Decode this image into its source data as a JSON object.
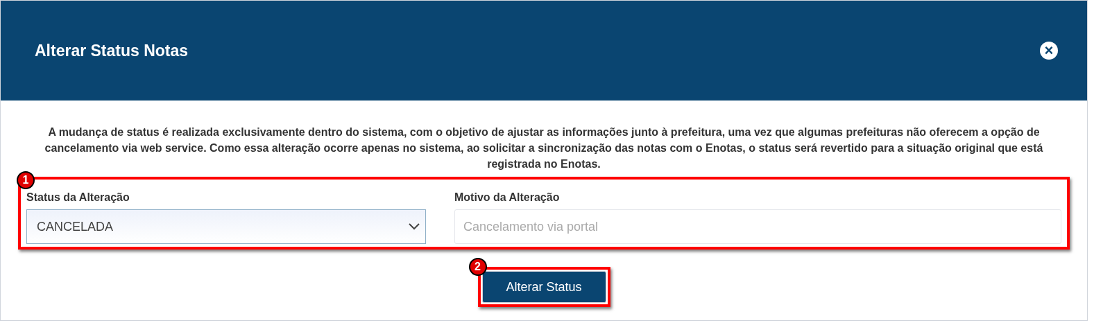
{
  "modal": {
    "title": "Alterar Status Notas",
    "close_icon": "×"
  },
  "description": "A mudança de status é realizada exclusivamente dentro do sistema, com o objetivo de ajustar as informações junto à prefeitura, uma vez que algumas prefeituras não oferecem a opção de cancelamento via web service. Como essa alteração ocorre apenas no sistema, ao solicitar a sincronização das notas com o Enotas, o status será revertido para a situação original que está registrada no Enotas.",
  "fields": [
    {
      "kind": "select",
      "label": "Status da Alteração",
      "value": "CANCELADA"
    },
    {
      "kind": "text",
      "label": "Motivo da Alteração",
      "placeholder": "Cancelamento via portal"
    }
  ],
  "submit_button": "Alterar Status",
  "callouts": [
    "1",
    "2"
  ]
}
